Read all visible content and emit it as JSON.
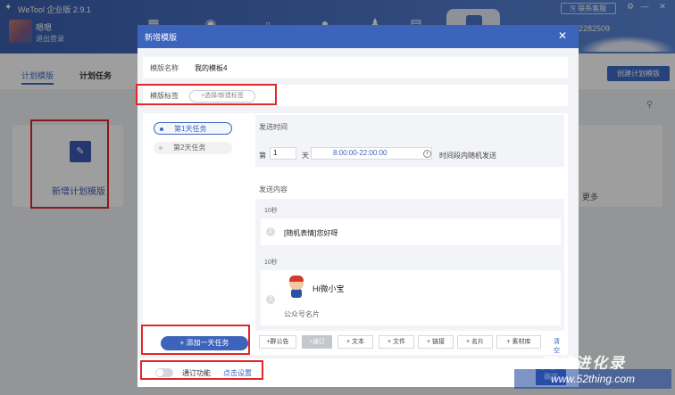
{
  "app": {
    "title": "WeTool 企业版 2.9.1",
    "user_name": "嗯嗯",
    "logout": "退出登录",
    "contact": "联系客服",
    "account_id": "2282509"
  },
  "tabs": {
    "templates": "计划模版",
    "tasks": "计划任务"
  },
  "create_button": "创建计划模版",
  "new_template_card": "新增计划模版",
  "more_link": "更多",
  "modal": {
    "title": "新增模版",
    "name_label": "模版名称",
    "name_value": "我的模板4",
    "tag_label": "模版标签",
    "tag_placeholder": "+选择/新建标签",
    "tasks": [
      "第1天任务",
      "第2天任务"
    ],
    "add_task": "+ 添加一天任务",
    "send_time_title": "发送时间",
    "day_prefix": "第",
    "day_value": "1",
    "day_suffix": "天",
    "time_range": "8:00:00-22:00:00",
    "random_note": "时间段内随机发送",
    "send_content_title": "发送内容",
    "messages": [
      {
        "delay": "10秒",
        "num": "1",
        "text": "[随机表情]您好呀"
      },
      {
        "delay": "10秒",
        "num": "2",
        "title": "Hi微小宝",
        "subtitle": "公众号名片"
      }
    ],
    "toolbar": [
      "+群公告",
      "+通订",
      "+ 文本",
      "+ 文件",
      "+ 链接",
      "+ 名片",
      "+ 素材库"
    ],
    "clear": "清空",
    "subscribe_label": "通订功能",
    "subscribe_settings": "点击设置",
    "confirm": "确定"
  },
  "watermark": {
    "brand": "网络进化录",
    "site": "www.52thing.com"
  },
  "colors": {
    "primary": "#3d64bb",
    "highlight_box": "#e02828"
  }
}
